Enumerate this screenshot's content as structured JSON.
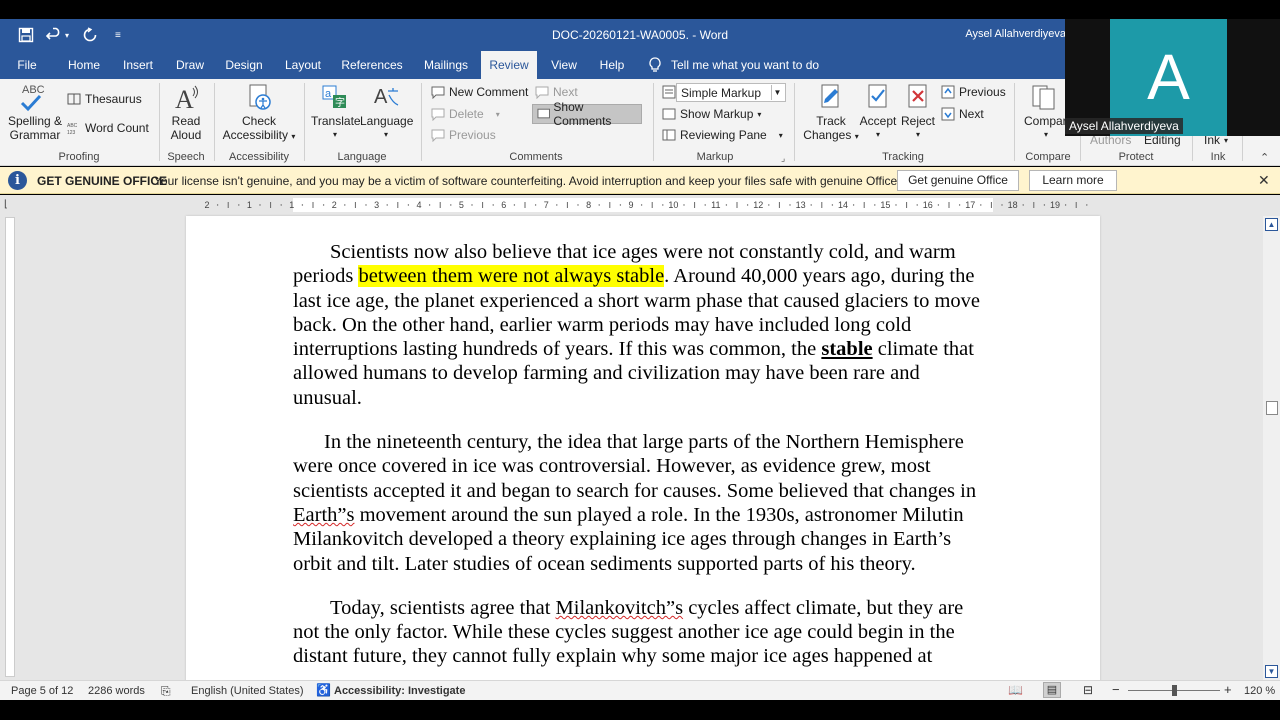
{
  "window": {
    "title": "DOC-20260121-WA0005.  -  Word",
    "user": "Aysel Allahverdiyeva"
  },
  "quick_access": {
    "save_icon": "save-icon",
    "undo_icon": "undo-icon",
    "redo_icon": "redo-icon",
    "customize_icon": "customize-icon"
  },
  "tabs": [
    {
      "label": "File"
    },
    {
      "label": "Home"
    },
    {
      "label": "Insert"
    },
    {
      "label": "Draw"
    },
    {
      "label": "Design"
    },
    {
      "label": "Layout"
    },
    {
      "label": "References"
    },
    {
      "label": "Mailings"
    },
    {
      "label": "Review"
    },
    {
      "label": "View"
    },
    {
      "label": "Help"
    }
  ],
  "tell_me": "Tell me what you want to do",
  "ribbon": {
    "proofing": {
      "spelling": "Spelling &",
      "grammar": "Grammar",
      "abc": "ABC",
      "thesaurus": "Thesaurus",
      "word_count": "Word Count",
      "label": "Proofing"
    },
    "speech": {
      "read": "Read",
      "aloud": "Aloud",
      "label": "Speech"
    },
    "accessibility": {
      "check": "Check",
      "accessibility": "Accessibility",
      "label": "Accessibility"
    },
    "language": {
      "translate": "Translate",
      "language": "Language",
      "label": "Language"
    },
    "comments": {
      "new_comment": "New Comment",
      "delete": "Delete",
      "previous": "Previous",
      "next": "Next",
      "show_comments": "Show Comments",
      "label": "Comments"
    },
    "markup": {
      "dropdown_value": "Simple Markup",
      "show_markup": "Show Markup",
      "reviewing_pane": "Reviewing Pane",
      "label": "Markup"
    },
    "tracking": {
      "track": "Track",
      "changes": "Changes",
      "accept": "Accept",
      "reject": "Reject",
      "previous": "Previous",
      "next": "Next",
      "label": "Tracking"
    },
    "compare": {
      "compare": "Compar",
      "label": "Compare"
    },
    "protect": {
      "authors": "Authors",
      "editing": "Editing",
      "label": "Protect"
    },
    "ink": {
      "ink": "Ink",
      "label": "Ink"
    }
  },
  "webcam": {
    "initial": "A",
    "name": "Aysel Allahverdiyeva"
  },
  "infobar": {
    "title": "GET GENUINE OFFICE",
    "message": "Your license isn't genuine, and you may be a victim of software counterfeiting. Avoid interruption and keep your files safe with genuine Office today.",
    "get_genuine": "Get genuine Office",
    "learn_more": "Learn more"
  },
  "ruler": [
    "2",
    "1",
    "1",
    "2",
    "3",
    "4",
    "5",
    "6",
    "7",
    "8",
    "9",
    "10",
    "11",
    "12",
    "13",
    "14",
    "15",
    "16",
    "17",
    "18",
    "19"
  ],
  "document": {
    "p1": {
      "a": "Scientists now also believe that ice ages were not constantly cold, and warm periods ",
      "highlight": "between them were not always stable",
      "b": ". Around 40,000 years ago, during the last ice age, the planet experienced a short warm phase that caused glaciers to move back. On the other hand, earlier warm periods may have included long cold interruptions lasting hundreds of years. If this was common, the ",
      "bold": "stable",
      "c": " climate that allowed humans to develop farming and civilization may have been rare and unusual."
    },
    "p2": {
      "a": "In the nineteenth century, the idea that large parts of the Northern Hemisphere were once covered in ice was controversial. However, as evidence grew, most scientists accepted it and began to search for causes. Some believed that changes in ",
      "squiggle": "Earth”s",
      "b": " movement around the sun played a role. In the 1930s, astronomer Milutin Milankovitch developed a theory explaining ice ages through changes in Earth’s orbit and tilt. Later studies of ocean sediments supported parts of his theory."
    },
    "p3": {
      "a": "Today, scientists agree that ",
      "squiggle": "Milankovitch”s",
      "b": " cycles affect climate, but they are not the only factor. While these cycles suggest another ice age could begin in the distant future, they cannot fully explain why some major ice ages happened at"
    }
  },
  "status": {
    "page": "Page 5 of 12",
    "words": "2286 words",
    "language": "English (United States)",
    "accessibility": "Accessibility: Investigate",
    "zoom": "120 %"
  }
}
